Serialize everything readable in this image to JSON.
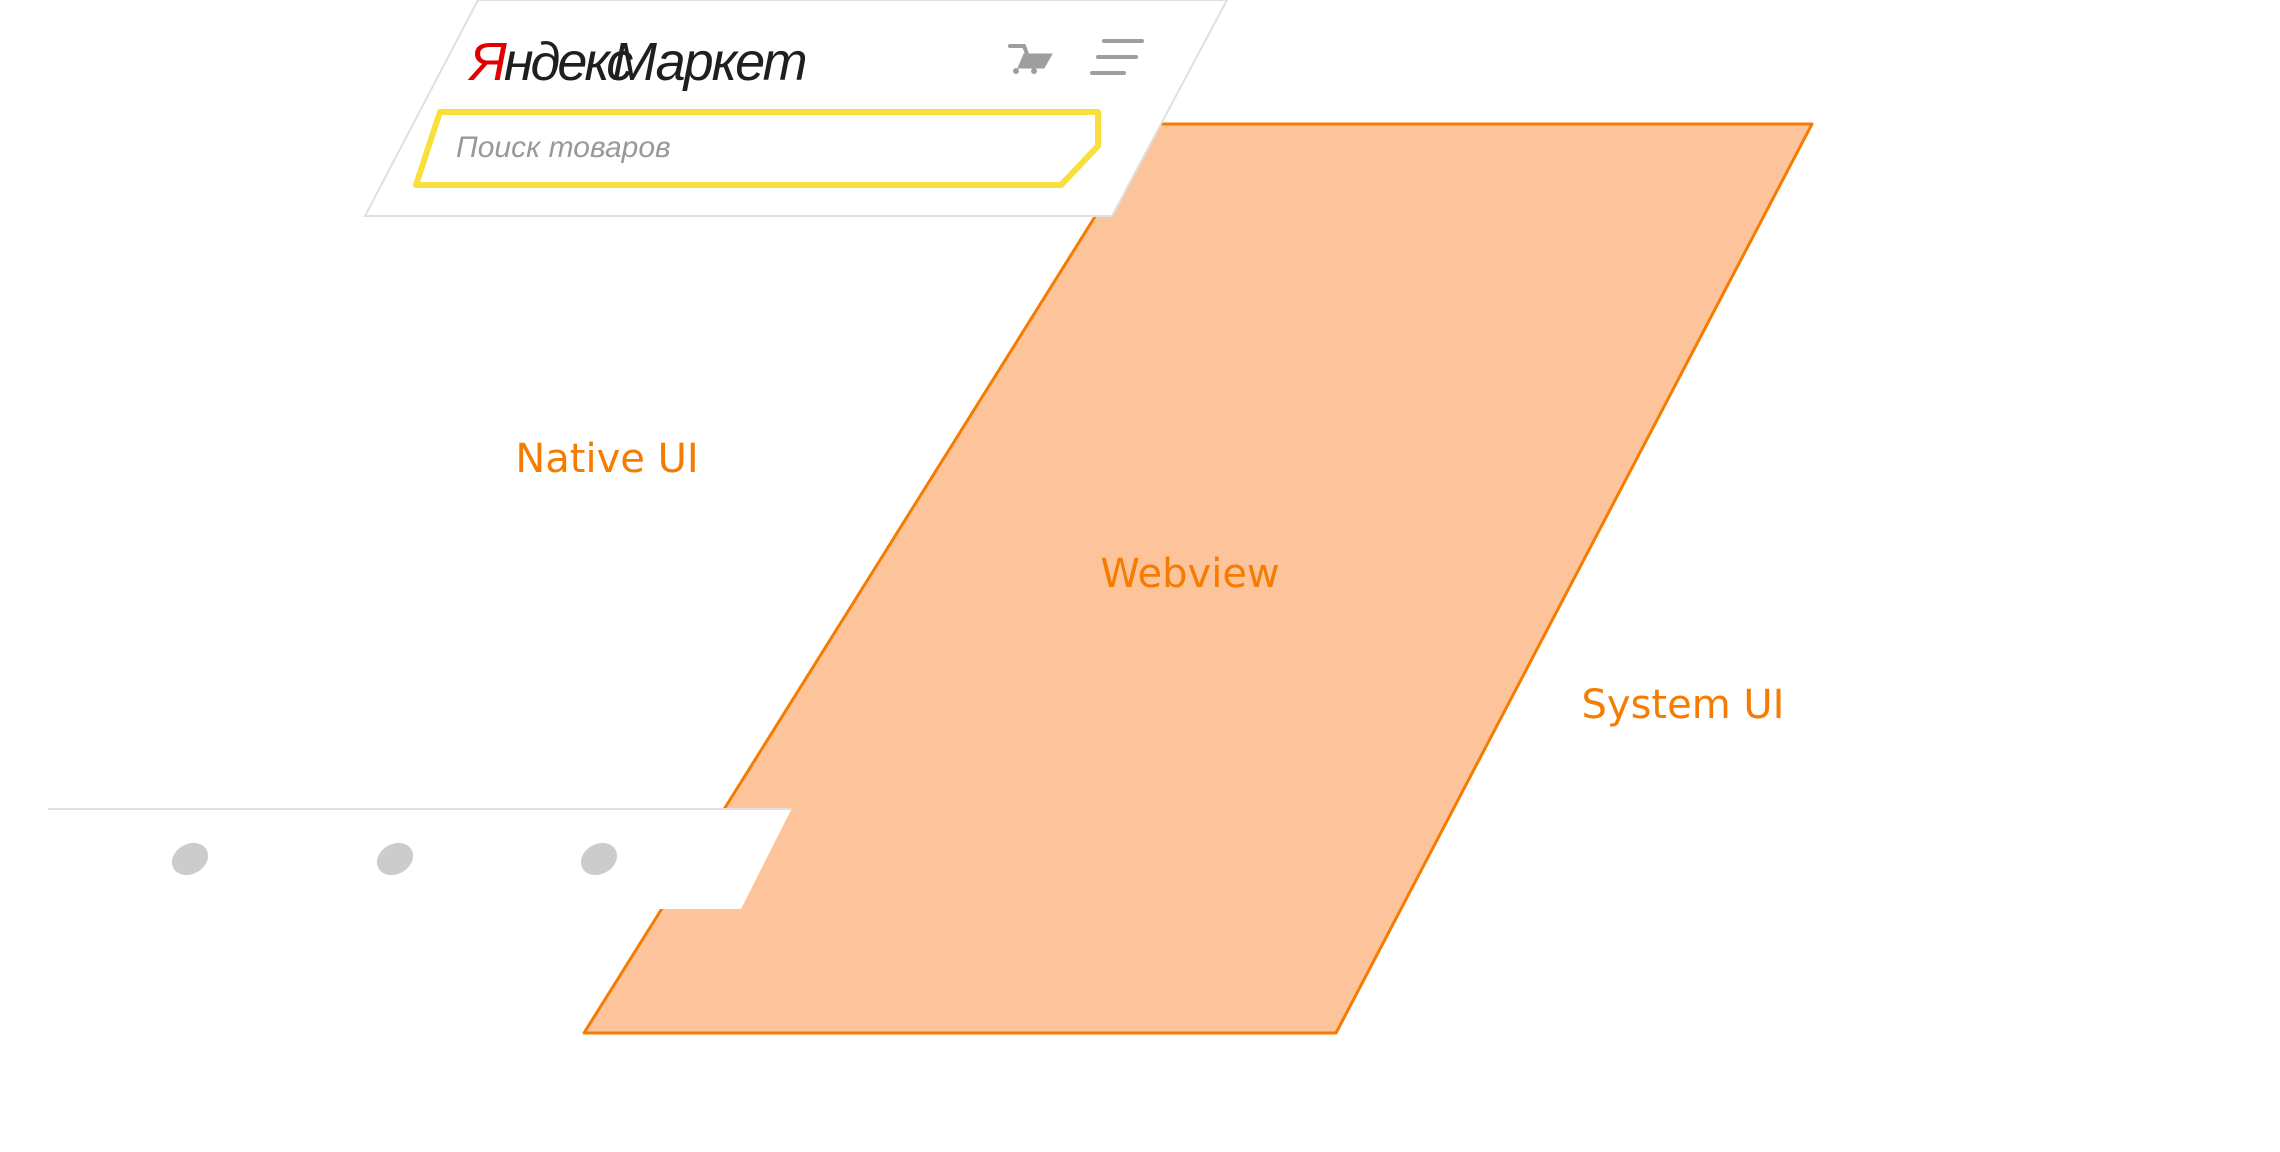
{
  "labels": {
    "native_ui": "Native UI",
    "webview": "Webview",
    "system_ui": "System UI"
  },
  "header": {
    "logo_yandex": "Яндекс",
    "logo_market": "Маркет",
    "search_placeholder": "Поиск товаров",
    "cart_icon": "cart-icon",
    "menu_icon": "hamburger-menu-icon"
  },
  "bottom_bar": {
    "tab_icons": [
      "tab-icon",
      "tab-icon",
      "tab-icon"
    ]
  },
  "colors": {
    "webview_fill": "#fdc49c",
    "webview_stroke": "#f57c00",
    "label_color": "#f57c00",
    "logo_red": "#e00000",
    "logo_dark": "#1f1f1f",
    "search_border": "#f8df3c",
    "placeholder": "#999999",
    "icon_gray": "#cccccc",
    "panel_border": "#dddddd"
  }
}
